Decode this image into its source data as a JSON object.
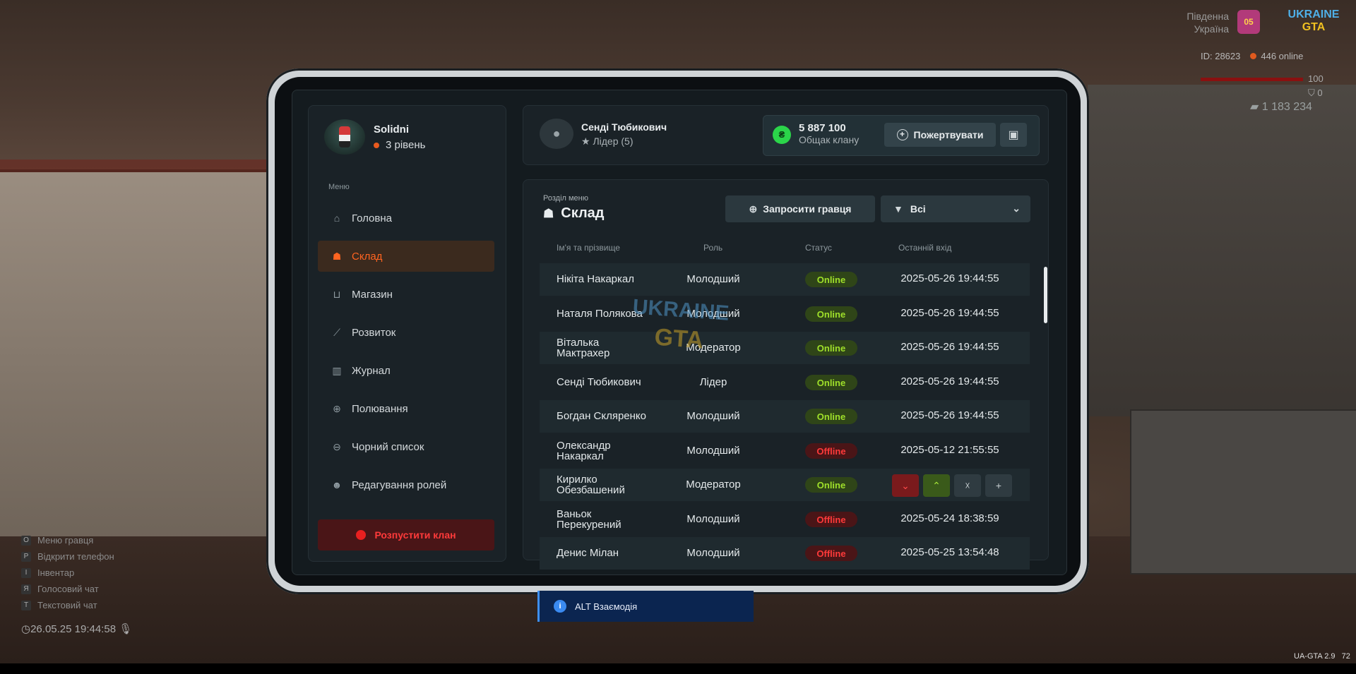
{
  "hud": {
    "region": "Південна Україна",
    "region_line1": "Південна",
    "region_line2": "Україна",
    "region_badge": "05",
    "logo_line1": "UKRAINE",
    "logo_line2": "GTA",
    "player_id": "ID: 28623",
    "online": "446 online",
    "health": "100",
    "armor": "0",
    "money": "1 183 234",
    "keys": [
      {
        "key": "O",
        "label": "Меню гравця"
      },
      {
        "key": "P",
        "label": "Відкрити телефон"
      },
      {
        "key": "I",
        "label": "Інвентар"
      },
      {
        "key": "Я",
        "label": "Голосовий чат"
      },
      {
        "key": "T",
        "label": "Текстовий чат"
      }
    ],
    "datetime": "26.05.25 19:44:58",
    "version": "UA-GTA 2.9",
    "fps": "72"
  },
  "user": {
    "name": "Solidni",
    "level": "3 рівень"
  },
  "sidebar": {
    "menu_label": "Меню",
    "items": [
      {
        "label": "Головна",
        "icon": "home-icon"
      },
      {
        "label": "Склад",
        "icon": "members-icon"
      },
      {
        "label": "Магазин",
        "icon": "basket-icon"
      },
      {
        "label": "Розвиток",
        "icon": "chart-icon"
      },
      {
        "label": "Журнал",
        "icon": "book-icon"
      },
      {
        "label": "Полювання",
        "icon": "crosshair-icon"
      },
      {
        "label": "Чорний список",
        "icon": "block-icon"
      },
      {
        "label": "Редагування ролей",
        "icon": "user-edit-icon"
      }
    ],
    "active_index": 1,
    "disband_label": "Розпустити клан"
  },
  "leader": {
    "name": "Сенді Тюбикович",
    "role": "Лідер (5)"
  },
  "bank": {
    "amount": "5 887 100",
    "label": "Общак клану",
    "donate_label": "Пожертвувати"
  },
  "section": {
    "label": "Розділ меню",
    "title": "Склад",
    "invite_label": "Запросити гравця",
    "filter_value": "Всі"
  },
  "table": {
    "headers": [
      "Ім'я та прізвище",
      "Роль",
      "Статус",
      "Останній вхід"
    ],
    "rows": [
      {
        "name": "Нікіта Накаркал",
        "name2": "",
        "role": "Молодший",
        "status": "Online",
        "last": "2025-05-26 19:44:55"
      },
      {
        "name": "Наталя Полякова",
        "name2": "",
        "role": "Молодший",
        "status": "Online",
        "last": "2025-05-26 19:44:55"
      },
      {
        "name": "Віталька",
        "name2": "Мактрахер",
        "role": "Модератор",
        "status": "Online",
        "last": "2025-05-26 19:44:55"
      },
      {
        "name": "Сенді Тюбикович",
        "name2": "",
        "role": "Лідер",
        "status": "Online",
        "last": "2025-05-26 19:44:55"
      },
      {
        "name": "Богдан Скляренко",
        "name2": "",
        "role": "Молодший",
        "status": "Online",
        "last": "2025-05-26 19:44:55"
      },
      {
        "name": "Олександр",
        "name2": "Накаркал",
        "role": "Молодший",
        "status": "Offline",
        "last": "2025-05-12 21:55:55"
      },
      {
        "name": "Кирилко",
        "name2": "Обезбашений",
        "role": "Модератор",
        "status": "Online",
        "last": ""
      },
      {
        "name": "Ваньок",
        "name2": "Перекурений",
        "role": "Молодший",
        "status": "Offline",
        "last": "2025-05-24 18:38:59"
      },
      {
        "name": "Денис Мілан",
        "name2": "",
        "role": "Молодший",
        "status": "Offline",
        "last": "2025-05-25 13:54:48"
      }
    ]
  },
  "watermark": {
    "line1": "UKRAINE",
    "line2": "GTA"
  },
  "interaction": {
    "text": "ALT Взаємодія"
  },
  "colors": {
    "accent": "#ff6420",
    "online": "#9fe02a",
    "offline": "#ff3a3a",
    "coin": "#2bd54a"
  }
}
